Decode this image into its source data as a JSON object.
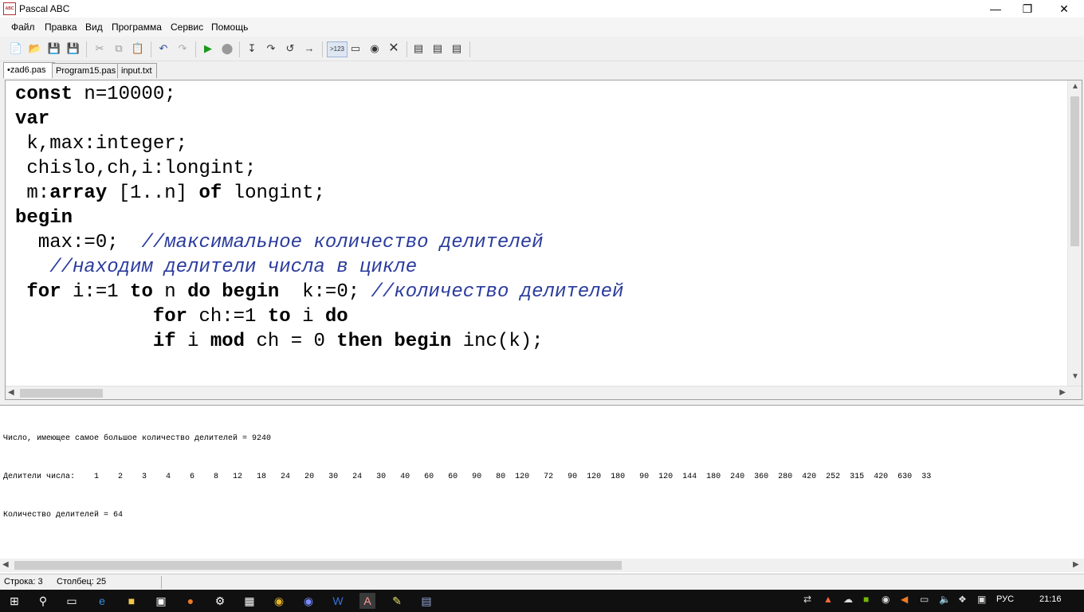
{
  "window": {
    "title": "Pascal ABC",
    "app_icon_glyph": "ABC"
  },
  "menu": [
    "Файл",
    "Правка",
    "Вид",
    "Программа",
    "Сервис",
    "Помощь"
  ],
  "toolbar": {
    "run_to_label": ">123"
  },
  "tabs": [
    "•zad6.pas",
    "Program15.pas",
    "input.txt"
  ],
  "code_lines": [
    [
      {
        "t": "const",
        "c": "kw"
      },
      {
        "t": " n=10000;"
      }
    ],
    [
      {
        "t": "var",
        "c": "kw"
      }
    ],
    [
      {
        "t": " k,max:integer;"
      }
    ],
    [
      {
        "t": " chislo,ch,i:longint;"
      }
    ],
    [
      {
        "t": " m:"
      },
      {
        "t": "array",
        "c": "kw"
      },
      {
        "t": " [1..n] "
      },
      {
        "t": "of",
        "c": "kw"
      },
      {
        "t": " longint;"
      }
    ],
    [
      {
        "t": "begin",
        "c": "kw"
      }
    ],
    [
      {
        "t": "  max:=0;  "
      },
      {
        "t": "//максимальное количество делителей",
        "c": "cm"
      }
    ],
    [
      {
        "t": "   "
      },
      {
        "t": "//находим делители числа в цикле",
        "c": "cm"
      }
    ],
    [
      {
        "t": " "
      },
      {
        "t": "for",
        "c": "kw"
      },
      {
        "t": " i:=1 "
      },
      {
        "t": "to",
        "c": "kw"
      },
      {
        "t": " n "
      },
      {
        "t": "do",
        "c": "kw"
      },
      {
        "t": " "
      },
      {
        "t": "begin",
        "c": "kw"
      },
      {
        "t": "  k:=0; "
      },
      {
        "t": "//количество делителей",
        "c": "cm"
      }
    ],
    [
      {
        "t": "            "
      },
      {
        "t": "for",
        "c": "kw"
      },
      {
        "t": " ch:=1 "
      },
      {
        "t": "to",
        "c": "kw"
      },
      {
        "t": " i "
      },
      {
        "t": "do",
        "c": "kw"
      }
    ],
    [
      {
        "t": "            "
      },
      {
        "t": "if",
        "c": "kw"
      },
      {
        "t": " i "
      },
      {
        "t": "mod",
        "c": "kw"
      },
      {
        "t": " ch = 0 "
      },
      {
        "t": "then",
        "c": "kw"
      },
      {
        "t": " "
      },
      {
        "t": "begin",
        "c": "kw"
      },
      {
        "t": " inc(k);"
      }
    ]
  ],
  "output_lines": [
    "Число, имеющее самое большое количество делителей = 9240",
    "Делители числа:    1    2    3    4    6    8   12   18   24   20   30   24   30   40   60   60   90   80  120   72   90  120  180   90  120  144  180  240  360  280  420  252  315  420  630  33",
    "Количество делителей = 64"
  ],
  "status": {
    "row": "Строка: 3",
    "col": "Столбец: 25"
  },
  "tray": {
    "lang": "РУС",
    "clock": "21:16"
  }
}
